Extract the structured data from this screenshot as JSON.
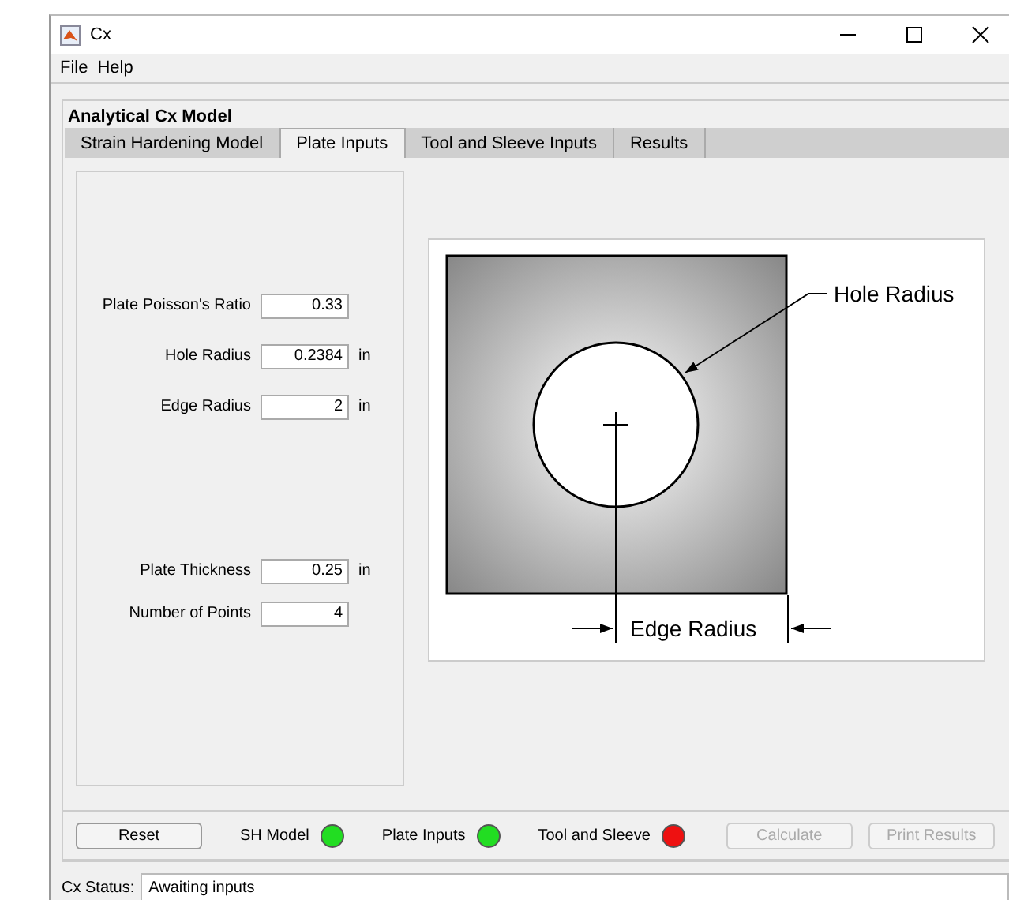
{
  "window": {
    "title": "Cx"
  },
  "menu": [
    "File",
    "Help"
  ],
  "panel": {
    "title": "Analytical Cx Model"
  },
  "tabs": [
    {
      "label": "Strain Hardening Model",
      "selected": false
    },
    {
      "label": "Plate Inputs",
      "selected": true
    },
    {
      "label": "Tool and Sleeve Inputs",
      "selected": false
    },
    {
      "label": "Results",
      "selected": false
    }
  ],
  "fields": [
    {
      "label": "Plate Poisson's Ratio",
      "value": "0.33"
    },
    {
      "label": "Hole Radius",
      "value": "0.2384",
      "unit": "in"
    },
    {
      "label": "Edge Radius",
      "value": "2",
      "unit": "in"
    }
  ],
  "lower_fields": [
    {
      "label": "Plate Thickness",
      "value": "0.25",
      "unit": "in"
    },
    {
      "label": "Number of Points",
      "value": "4"
    }
  ],
  "diagram": {
    "hole_label": "Hole Radius",
    "edge_label": "Edge Radius"
  },
  "bottom": {
    "reset": "Reset",
    "indicators": [
      {
        "label": "SH Model",
        "color": "#22dd22"
      },
      {
        "label": "Plate Inputs",
        "color": "#22dd22"
      },
      {
        "label": "Tool and Sleeve",
        "color": "#ee1111"
      }
    ],
    "buttons": [
      {
        "label": "Calculate",
        "disabled": true
      },
      {
        "label": "Print Results",
        "disabled": true
      }
    ]
  },
  "status": {
    "label": "Cx Status:",
    "value": "Awaiting inputs"
  }
}
